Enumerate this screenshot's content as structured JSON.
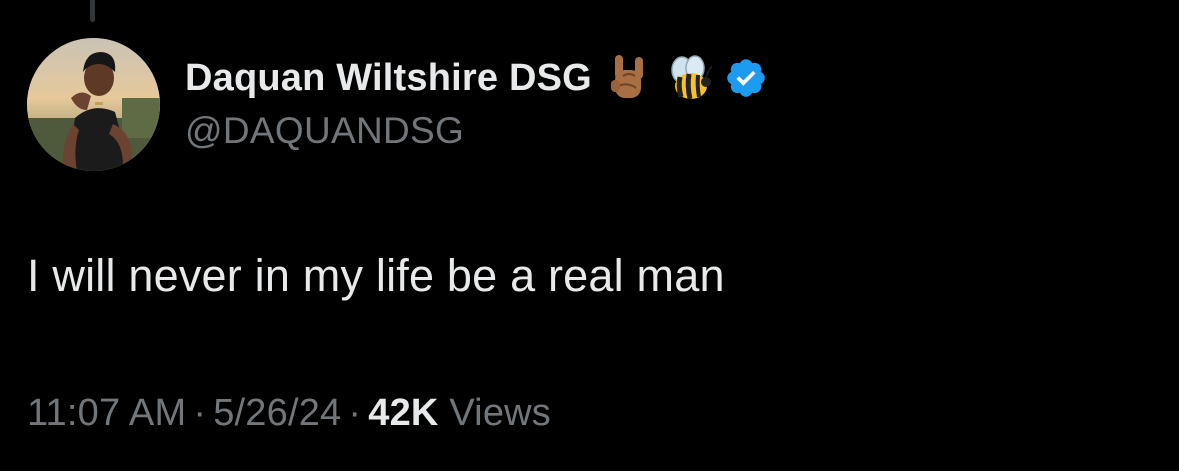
{
  "tweet": {
    "author": {
      "display_name": "Daquan Wiltshire DSG",
      "handle": "@DAQUANDSG",
      "badges": [
        "horns-sign-emoji-icon",
        "honeybee-emoji-icon",
        "verified-badge-icon"
      ]
    },
    "text": "I will never in my life be a real man",
    "time": "11:07 AM",
    "separator": "·",
    "date": "5/26/24",
    "views_count": "42K",
    "views_label": "Views"
  },
  "colors": {
    "background": "#000000",
    "primary_text": "#e7e9ea",
    "secondary_text": "#71767b",
    "verified_blue": "#1d9bf0"
  }
}
